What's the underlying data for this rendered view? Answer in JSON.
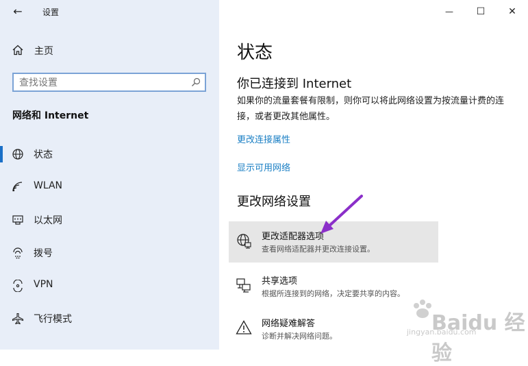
{
  "window": {
    "title": "设置",
    "controls": {
      "minimize": "—",
      "maximize": "☐",
      "close": "✕"
    }
  },
  "sidebar": {
    "back_icon": "←",
    "home_label": "主页",
    "search": {
      "placeholder": "查找设置",
      "value": ""
    },
    "section_title": "网络和 Internet",
    "items": [
      {
        "label": "状态",
        "icon": "globe-icon",
        "active": true
      },
      {
        "label": "WLAN",
        "icon": "wifi-icon",
        "active": false
      },
      {
        "label": "以太网",
        "icon": "ethernet-icon",
        "active": false
      },
      {
        "label": "拨号",
        "icon": "dialup-icon",
        "active": false
      },
      {
        "label": "VPN",
        "icon": "vpn-icon",
        "active": false
      },
      {
        "label": "飞行模式",
        "icon": "airplane-icon",
        "active": false
      }
    ]
  },
  "main": {
    "page_title": "状态",
    "connection_heading": "你已连接到 Internet",
    "connection_desc": "如果你的流量套餐有限制，则你可以将此网络设置为按流量计费的连接，或者更改其他属性。",
    "links": [
      "更改连接属性",
      "显示可用网络"
    ],
    "change_heading": "更改网络设置",
    "options": [
      {
        "title": "更改适配器选项",
        "desc": "查看网络适配器并更改连接设置。",
        "icon": "adapter-globe-icon",
        "highlighted": true
      },
      {
        "title": "共享选项",
        "desc": "根据所连接到的网络，决定要共享的内容。",
        "icon": "sharing-icon",
        "highlighted": false
      },
      {
        "title": "网络疑难解答",
        "desc": "诊断并解决网络问题。",
        "icon": "warning-icon",
        "highlighted": false
      }
    ]
  },
  "annotation": {
    "color": "#8b2fc9"
  },
  "watermark": {
    "brand": "Baidu 经验",
    "url": "jingyan.baidu.com"
  },
  "colors": {
    "sidebar_bg": "#e8eef8",
    "accent": "#1a6fc7",
    "link": "#1a7fc4",
    "highlight_bg": "#e6e6e6"
  }
}
